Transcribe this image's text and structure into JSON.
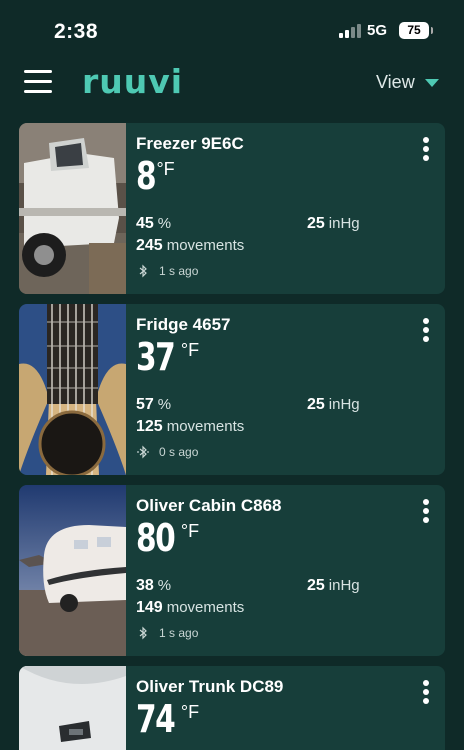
{
  "status_bar": {
    "time": "2:38",
    "network": "5G",
    "battery": "75"
  },
  "header": {
    "logo": "ruuvi",
    "view_label": "View"
  },
  "colors": {
    "background": "#0f2a28",
    "card": "#173e3a",
    "accent": "#4ec9b3"
  },
  "sensors": [
    {
      "name": "Freezer 9E6C",
      "temperature": "8",
      "temp_unit": "°F",
      "humidity": "45",
      "humidity_unit": "%",
      "pressure": "25",
      "pressure_unit": "inHg",
      "movements": "245",
      "movements_label": "movements",
      "last_seen": "1 s ago",
      "icon": "bluetooth-icon"
    },
    {
      "name": "Fridge 4657",
      "temperature": "37",
      "temp_unit": "°F",
      "humidity": "57",
      "humidity_unit": "%",
      "pressure": "25",
      "pressure_unit": "inHg",
      "movements": "125",
      "movements_label": "movements",
      "last_seen": "0 s ago",
      "icon": "bluetooth-icon"
    },
    {
      "name": "Oliver Cabin C868",
      "temperature": "80",
      "temp_unit": "°F",
      "humidity": "38",
      "humidity_unit": "%",
      "pressure": "25",
      "pressure_unit": "inHg",
      "movements": "149",
      "movements_label": "movements",
      "last_seen": "1 s ago",
      "icon": "bluetooth-icon"
    },
    {
      "name": "Oliver Trunk DC89",
      "temperature": "74",
      "temp_unit": "°F",
      "icon": "bluetooth-icon"
    }
  ]
}
